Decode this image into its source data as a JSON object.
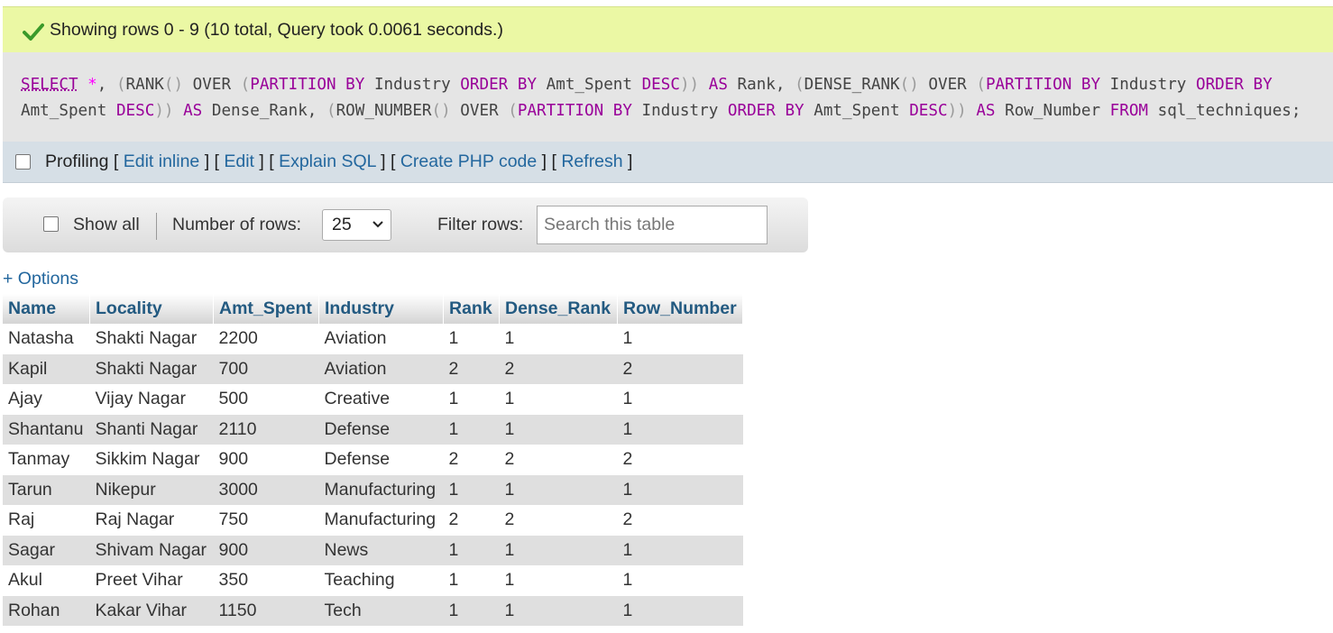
{
  "status": {
    "icon": "check-icon",
    "message": "Showing rows 0 - 9 (10 total, Query took 0.0061 seconds.)"
  },
  "sql": {
    "line1": [
      {
        "t": "SELECT",
        "c": "kw-ul"
      },
      {
        "t": " ",
        "c": "fn"
      },
      {
        "t": "*",
        "c": "op"
      },
      {
        "t": ", ",
        "c": "fn"
      },
      {
        "t": "(",
        "c": "pn"
      },
      {
        "t": "RANK",
        "c": "fn"
      },
      {
        "t": "()",
        "c": "pn"
      },
      {
        "t": " OVER ",
        "c": "fn"
      },
      {
        "t": "(",
        "c": "pn"
      },
      {
        "t": "PARTITION BY",
        "c": "kw"
      },
      {
        "t": " Industry ",
        "c": "col"
      },
      {
        "t": "ORDER BY",
        "c": "kw"
      },
      {
        "t": " Amt_Spent ",
        "c": "col"
      },
      {
        "t": "DESC",
        "c": "kw"
      },
      {
        "t": "))",
        "c": "pn"
      },
      {
        "t": " ",
        "c": "fn"
      },
      {
        "t": "AS",
        "c": "kw"
      },
      {
        "t": " Rank, ",
        "c": "col"
      },
      {
        "t": "(",
        "c": "pn"
      },
      {
        "t": "DENSE_RANK",
        "c": "fn"
      },
      {
        "t": "()",
        "c": "pn"
      },
      {
        "t": " OVER ",
        "c": "fn"
      },
      {
        "t": "(",
        "c": "pn"
      },
      {
        "t": "PARTITION BY",
        "c": "kw"
      },
      {
        "t": " Industry ",
        "c": "col"
      },
      {
        "t": "ORDER BY",
        "c": "kw"
      }
    ],
    "line2": [
      {
        "t": "Amt_Spent ",
        "c": "col"
      },
      {
        "t": "DESC",
        "c": "kw"
      },
      {
        "t": "))",
        "c": "pn"
      },
      {
        "t": " ",
        "c": "fn"
      },
      {
        "t": "AS",
        "c": "kw"
      },
      {
        "t": " Dense_Rank, ",
        "c": "col"
      },
      {
        "t": "(",
        "c": "pn"
      },
      {
        "t": "ROW_NUMBER",
        "c": "fn"
      },
      {
        "t": "()",
        "c": "pn"
      },
      {
        "t": " OVER ",
        "c": "fn"
      },
      {
        "t": "(",
        "c": "pn"
      },
      {
        "t": "PARTITION BY",
        "c": "kw"
      },
      {
        "t": " Industry ",
        "c": "col"
      },
      {
        "t": "ORDER BY",
        "c": "kw"
      },
      {
        "t": " Amt_Spent ",
        "c": "col"
      },
      {
        "t": "DESC",
        "c": "kw"
      },
      {
        "t": "))",
        "c": "pn"
      },
      {
        "t": " ",
        "c": "fn"
      },
      {
        "t": "AS",
        "c": "kw"
      },
      {
        "t": " Row_Number ",
        "c": "col"
      },
      {
        "t": "FROM",
        "c": "kw"
      },
      {
        "t": " sql_techniques;",
        "c": "col"
      }
    ]
  },
  "profiling": {
    "label": "Profiling",
    "links": [
      "Edit inline",
      "Edit",
      "Explain SQL",
      "Create PHP code",
      "Refresh"
    ]
  },
  "navigation": {
    "show_all_label": "Show all",
    "rows_label": "Number of rows:",
    "rows_value": "25",
    "filter_label": "Filter rows:",
    "filter_placeholder": "Search this table"
  },
  "options_link": "+ Options",
  "table": {
    "headers": [
      "Name",
      "Locality",
      "Amt_Spent",
      "Industry",
      "Rank",
      "Dense_Rank",
      "Row_Number"
    ],
    "rows": [
      [
        "Natasha",
        "Shakti Nagar",
        "2200",
        "Aviation",
        "1",
        "1",
        "1"
      ],
      [
        "Kapil",
        "Shakti Nagar",
        "700",
        "Aviation",
        "2",
        "2",
        "2"
      ],
      [
        "Ajay",
        "Vijay Nagar",
        "500",
        "Creative",
        "1",
        "1",
        "1"
      ],
      [
        "Shantanu",
        "Shanti Nagar",
        "2110",
        "Defense",
        "1",
        "1",
        "1"
      ],
      [
        "Tanmay",
        "Sikkim Nagar",
        "900",
        "Defense",
        "2",
        "2",
        "2"
      ],
      [
        "Tarun",
        "Nikepur",
        "3000",
        "Manufacturing",
        "1",
        "1",
        "1"
      ],
      [
        "Raj",
        "Raj Nagar",
        "750",
        "Manufacturing",
        "2",
        "2",
        "2"
      ],
      [
        "Sagar",
        "Shivam Nagar",
        "900",
        "News",
        "1",
        "1",
        "1"
      ],
      [
        "Akul",
        "Preet Vihar",
        "350",
        "Teaching",
        "1",
        "1",
        "1"
      ],
      [
        "Rohan",
        "Kakar Vihar",
        "1150",
        "Tech",
        "1",
        "1",
        "1"
      ]
    ]
  },
  "colors": {
    "success_bg": "#ebf8a4",
    "sql_bg": "#e5e5e5",
    "keyword": "#990099",
    "link": "#23679e",
    "header_text": "#235a81",
    "row_alt": "#dfdfdf"
  }
}
